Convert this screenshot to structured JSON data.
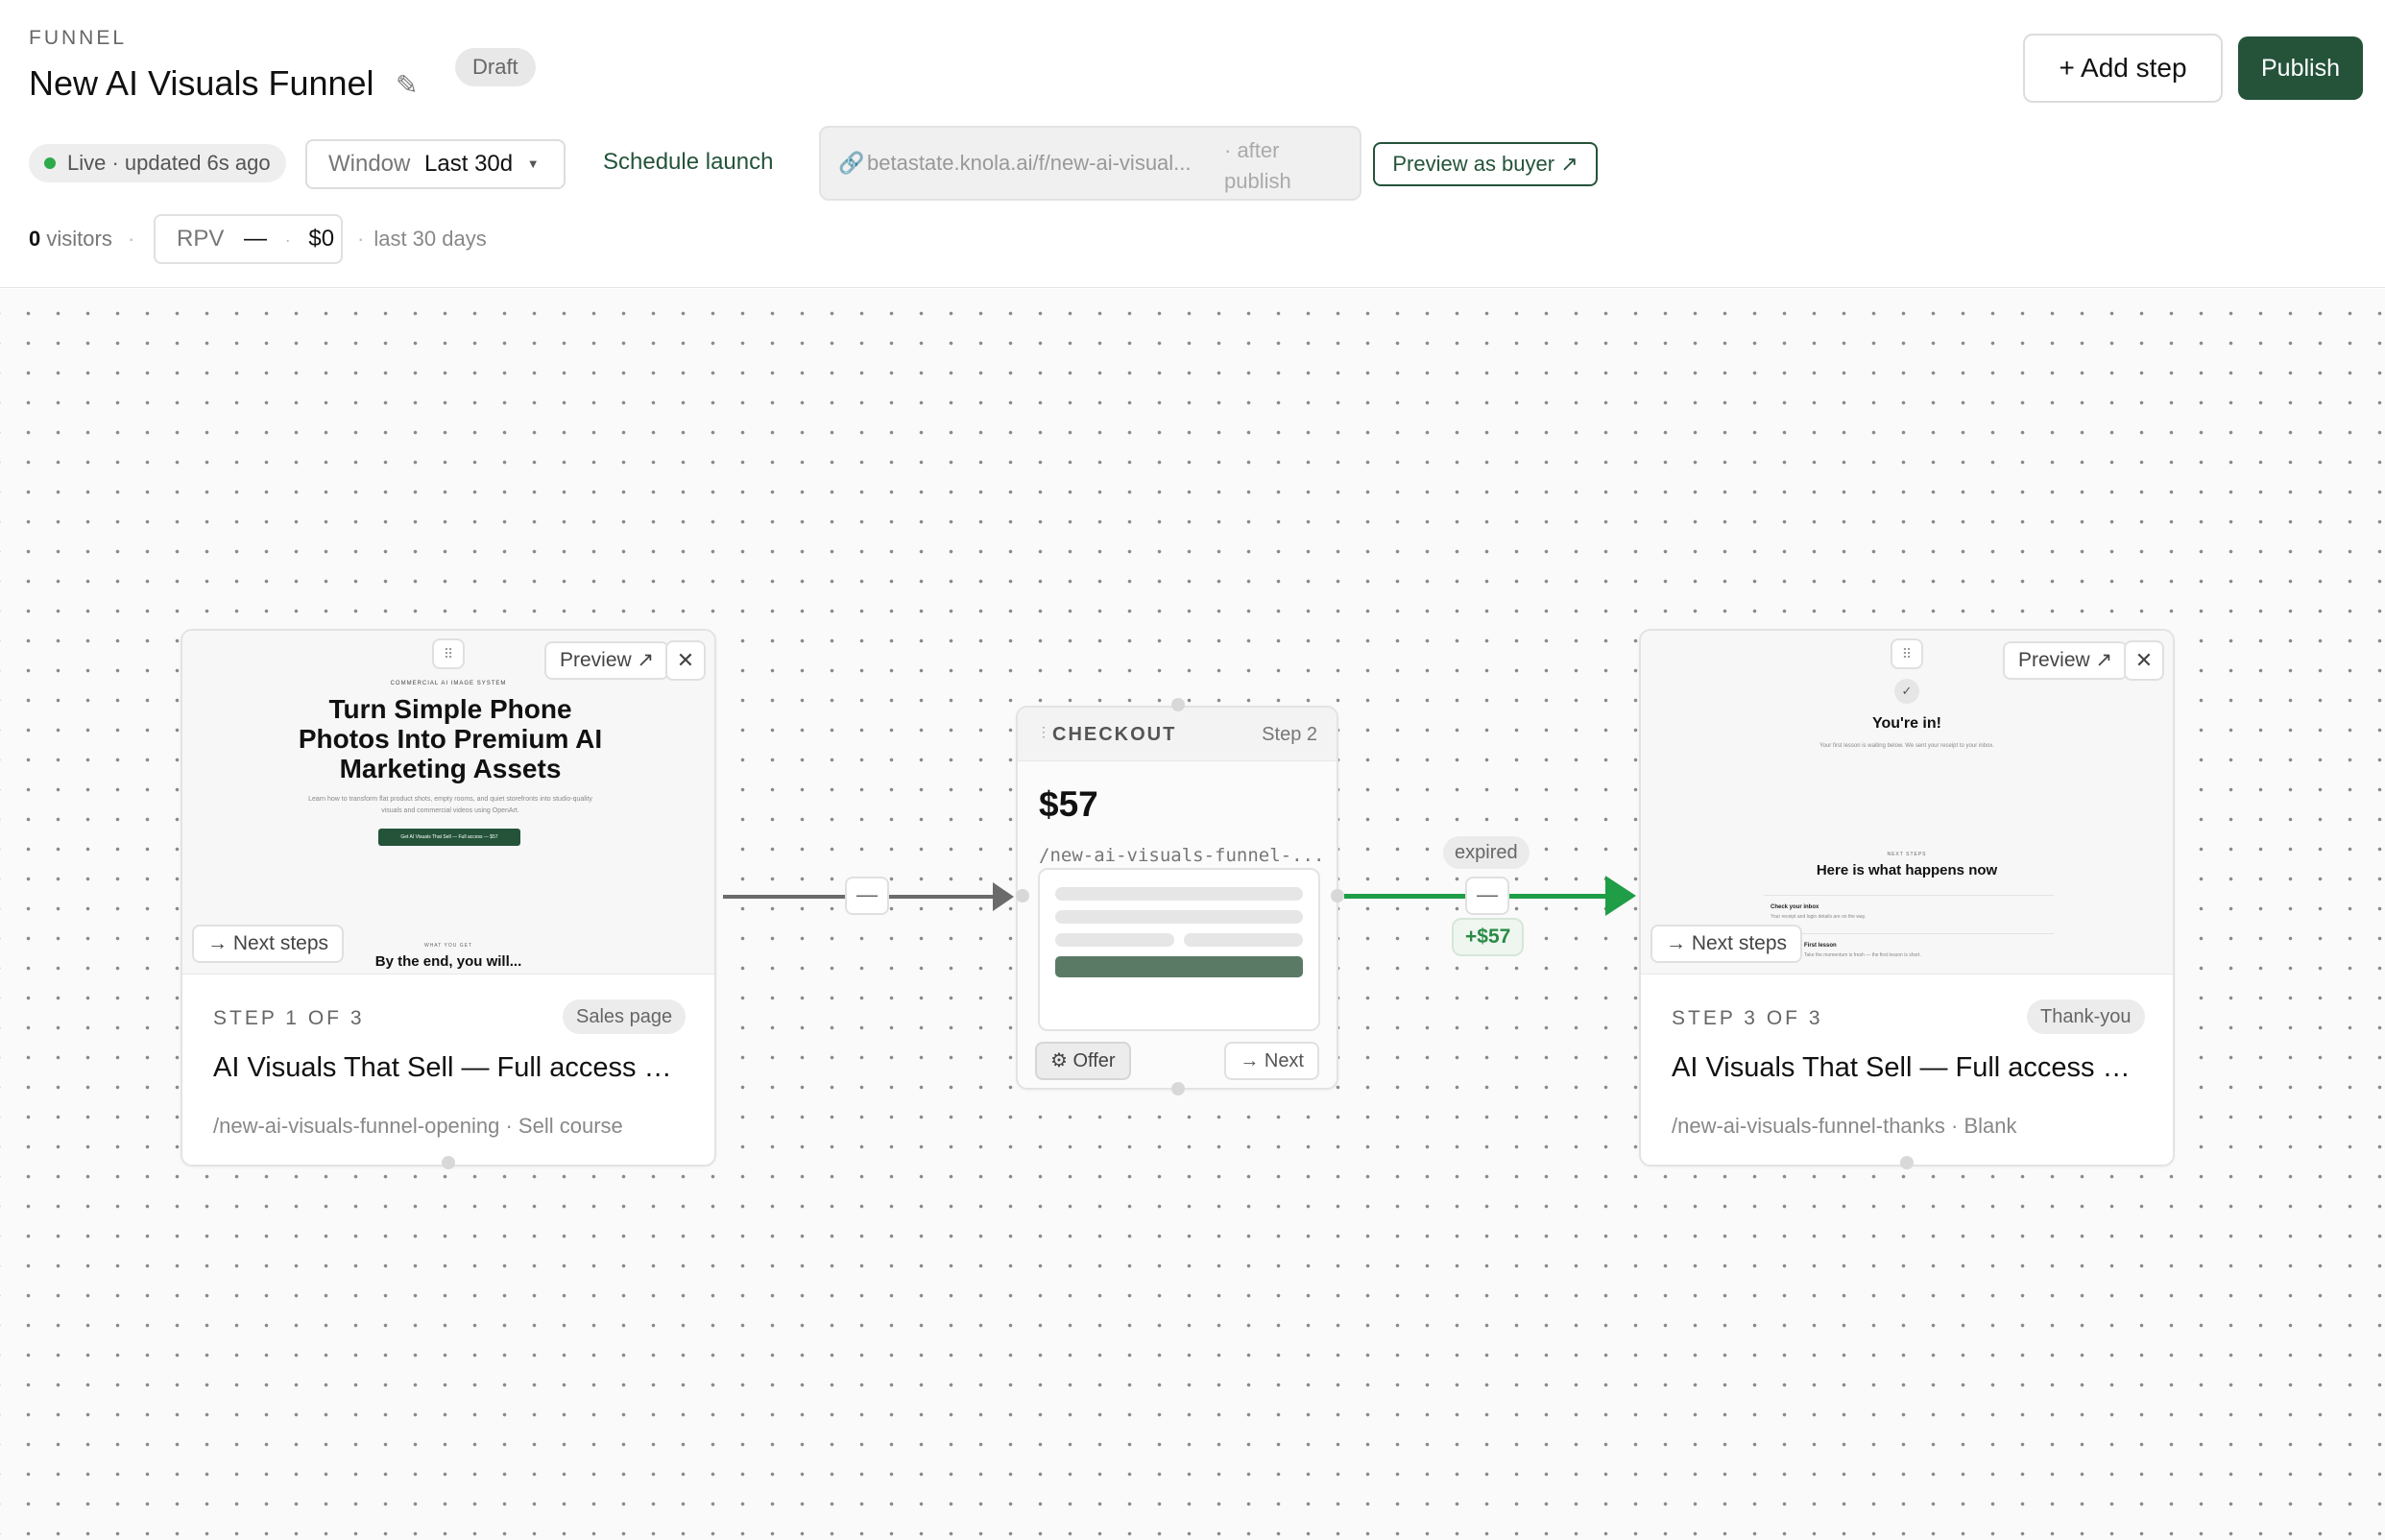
{
  "header": {
    "eyebrow": "FUNNEL",
    "title": "New AI Visuals Funnel",
    "status_badge": "Draft",
    "add_step_label": "+ Add step",
    "publish_label": "Publish"
  },
  "toolbar": {
    "live_label": "Live · updated 6s ago",
    "window_label": "Window",
    "window_value": "Last 30d",
    "schedule_label": "Schedule launch",
    "url": "betastate.knola.ai/f/new-ai-visual...",
    "url_note": "· after publish",
    "preview_buyer_label": "Preview as buyer ↗"
  },
  "stats": {
    "visitors_count": "0",
    "visitors_label": "visitors",
    "rpv_label": "RPV",
    "rpv_value": "—",
    "revenue": "$0",
    "period": "last 30 days"
  },
  "colors": {
    "brand": "#24533a",
    "live_dot": "#2eaa4a",
    "success_edge": "#1f9d47",
    "default_edge": "#6b6b6b"
  },
  "steps": [
    {
      "preview_label": "Preview ↗",
      "next_steps_label": "→ Next steps",
      "step_label": "STEP 1 OF 3",
      "type": "Sales page",
      "title": "AI Visuals That Sell — Full access — ...",
      "path": "/new-ai-visuals-funnel-opening · Sell course",
      "thumb": {
        "eyebrow": "COMMERCIAL AI IMAGE SYSTEM",
        "headline": "Turn Simple Phone Photos Into Premium AI Marketing Assets",
        "body": "Learn how to transform flat product shots, empty rooms, and quiet storefronts into studio-quality visuals and commercial videos using OpenArt.",
        "cta": "Get AI Visuals That Sell — Full access — $57",
        "section_eyebrow": "WHAT YOU GET",
        "section_title": "By the end, you will..."
      }
    },
    {
      "kind_label": "CHECKOUT",
      "step_label": "Step 2",
      "price": "$57",
      "path": "/new-ai-visuals-funnel-...",
      "offer_label": "⚙ Offer",
      "next_label": "→ Next"
    },
    {
      "preview_label": "Preview ↗",
      "next_steps_label": "→ Next steps",
      "step_label": "STEP 3 OF 3",
      "type": "Thank-you",
      "title": "AI Visuals That Sell — Full access — ...",
      "path": "/new-ai-visuals-funnel-thanks · Blank",
      "thumb": {
        "headline": "You're in!",
        "body": "Your first lesson is waiting below. We sent your receipt to your inbox.",
        "section_eyebrow": "NEXT STEPS",
        "section_title": "Here is what happens now",
        "item1": "Check your inbox",
        "item1_body": "Your receipt and login details are on the way.",
        "item2": "First lesson",
        "item2_body": "Take the momentum is fresh — the first lesson is short."
      }
    }
  ],
  "edges": {
    "edge1_button": "—",
    "edge2_badge": "expired",
    "edge2_button": "—",
    "edge2_amount": "+$57"
  }
}
